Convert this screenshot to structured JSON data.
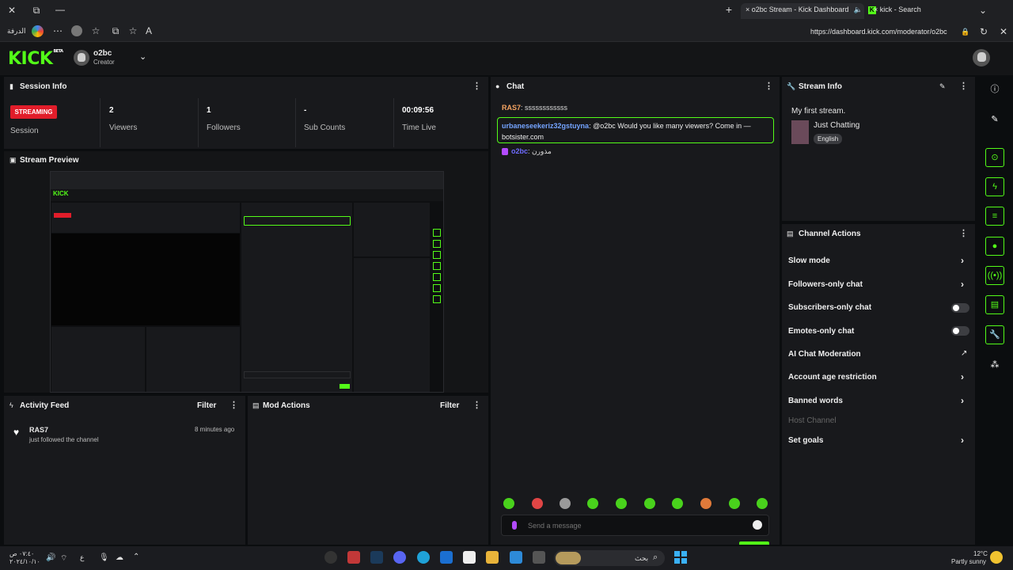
{
  "browser": {
    "tabs": [
      {
        "label": "o2bc Stream - Kick Dashboard",
        "active": true
      },
      {
        "label": "kick - Search",
        "active": false
      }
    ],
    "address": "https://dashboard.kick.com/moderator/o2bc",
    "back_label": "الدرفة",
    "tab_close": "×",
    "new_tab": "+"
  },
  "app": {
    "logo": "KICK",
    "logo_beta": "BETA",
    "user_name": "o2bc",
    "user_role": "Creator"
  },
  "session_info": {
    "title": "Session Info",
    "status_badge": "STREAMING",
    "status_label": "Session",
    "stats": [
      {
        "value": "2",
        "label": "Viewers"
      },
      {
        "value": "1",
        "label": "Followers"
      },
      {
        "value": "-",
        "label": "Sub Counts"
      },
      {
        "value": "00:09:56",
        "label": "Time Live"
      }
    ]
  },
  "stream_preview": {
    "title": "Stream Preview"
  },
  "activity_feed": {
    "title": "Activity Feed",
    "filter_label": "Filter",
    "items": [
      {
        "user": "RAS7",
        "text": "just followed the channel",
        "time": "8 minutes ago"
      }
    ]
  },
  "mod_actions": {
    "title": "Mod Actions",
    "filter_label": "Filter"
  },
  "chat": {
    "title": "Chat",
    "messages": [
      {
        "user": "RAS7",
        "text": "ssssssssssss",
        "user_color": "#f5a462"
      },
      {
        "user": "urbaneseekeriz32gstuyna",
        "text": "@o2bc Would you like many viewers? Come in — botsister.com",
        "user_color": "#74a4ff",
        "highlighted": true
      },
      {
        "user": "o2bc",
        "text": "مذورن",
        "user_color": "#6f6cff"
      }
    ],
    "input_placeholder": "Send a message"
  },
  "stream_info": {
    "title": "Stream Info",
    "stream_title": "My first stream.",
    "category": "Just Chatting",
    "language": "English"
  },
  "channel_actions": {
    "title": "Channel Actions",
    "items": [
      {
        "label": "Slow mode",
        "control": "chevron"
      },
      {
        "label": "Followers-only chat",
        "control": "chevron"
      },
      {
        "label": "Subscribers-only chat",
        "control": "toggle",
        "enabled": false
      },
      {
        "label": "Emotes-only chat",
        "control": "toggle",
        "enabled": false
      },
      {
        "label": "AI Chat Moderation",
        "control": "external"
      },
      {
        "label": "Account age restriction",
        "control": "chevron"
      },
      {
        "label": "Banned words",
        "control": "chevron"
      },
      {
        "label": "Host Channel",
        "control": "none",
        "disabled": true
      },
      {
        "label": "Set goals",
        "control": "chevron"
      }
    ]
  },
  "taskbar": {
    "time": "٠٧:٤٠ ص",
    "date": "٢٠٢٤/١٠/١٠",
    "lang": "ع",
    "search_label": "بحث",
    "weather_temp": "12°C",
    "weather_text": "Partly sunny"
  },
  "colors": {
    "accent": "#53fc18",
    "live": "#e11d2a",
    "panel": "#18191c",
    "background": "#0b0d0f"
  }
}
